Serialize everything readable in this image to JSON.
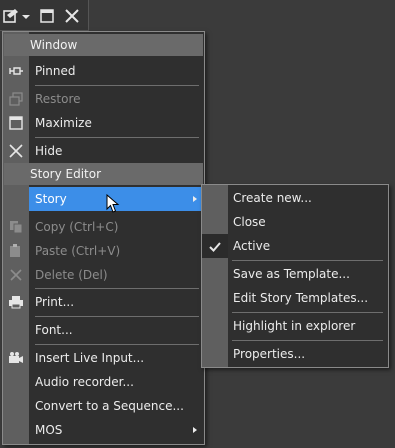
{
  "menu": {
    "window_header": "Window",
    "pinned": "Pinned",
    "restore": "Restore",
    "maximize": "Maximize",
    "hide": "Hide",
    "story_editor_header": "Story Editor",
    "story": "Story",
    "copy": "Copy (Ctrl+C)",
    "paste": "Paste (Ctrl+V)",
    "delete": "Delete (Del)",
    "print": "Print...",
    "font": "Font...",
    "insert_live_input": "Insert Live Input...",
    "audio_recorder": "Audio recorder...",
    "convert_sequence": "Convert to a Sequence...",
    "mos": "MOS"
  },
  "submenu": {
    "create_new": "Create new...",
    "close": "Close",
    "active": "Active",
    "save_as_template": "Save as Template...",
    "edit_story_templates": "Edit Story Templates...",
    "highlight_in_explorer": "Highlight in explorer",
    "properties": "Properties..."
  },
  "colors": {
    "selection": "#3c8ee8",
    "background": "#3b3b3b",
    "menu_bg": "#2f2f2f",
    "header_bg": "#6a6a6a"
  },
  "icons": [
    "menu-icon",
    "dropdown-arrow-icon",
    "maximize-icon",
    "close-icon",
    "pin-icon",
    "restore-icon",
    "hide-icon",
    "copy-icon",
    "paste-icon",
    "delete-icon",
    "print-icon",
    "live-input-icon",
    "checkmark-icon",
    "mouse-cursor-icon"
  ]
}
